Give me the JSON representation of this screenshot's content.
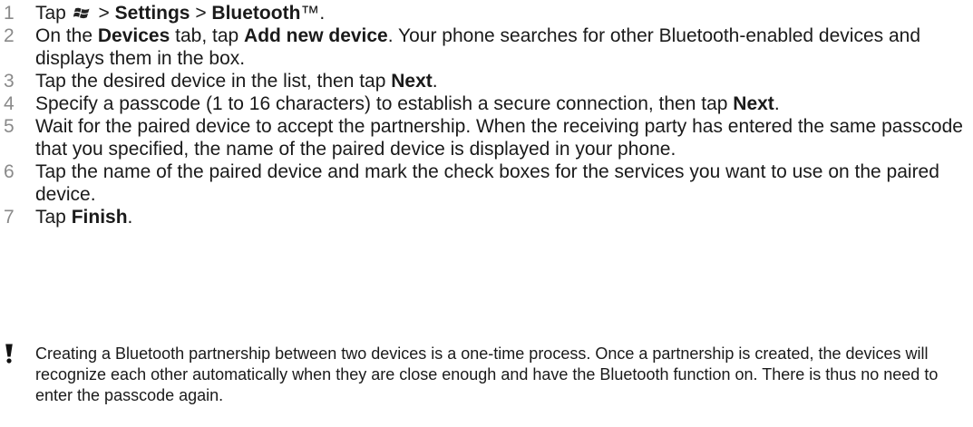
{
  "steps": [
    {
      "number": "1",
      "parts": [
        {
          "t": "Tap "
        },
        {
          "icon": "windows-start-icon"
        },
        {
          "t": " > "
        },
        {
          "b": "Settings"
        },
        {
          "t": " > "
        },
        {
          "b": "Bluetooth"
        },
        {
          "t": "™."
        }
      ]
    },
    {
      "number": "2",
      "parts": [
        {
          "t": "On the "
        },
        {
          "b": "Devices"
        },
        {
          "t": " tab, tap "
        },
        {
          "b": "Add new device"
        },
        {
          "t": ". Your phone searches for other Bluetooth-enabled devices and displays them in the box."
        }
      ]
    },
    {
      "number": "3",
      "parts": [
        {
          "t": "Tap the desired device in the list, then tap "
        },
        {
          "b": "Next"
        },
        {
          "t": "."
        }
      ]
    },
    {
      "number": "4",
      "parts": [
        {
          "t": "Specify a passcode (1 to 16 characters) to establish a secure connection, then tap "
        },
        {
          "b": "Next"
        },
        {
          "t": "."
        }
      ]
    },
    {
      "number": "5",
      "parts": [
        {
          "t": "Wait for the paired device to accept the partnership. When the receiving party has entered the same passcode that you specified, the name of the paired device is displayed in your phone."
        }
      ]
    },
    {
      "number": "6",
      "parts": [
        {
          "t": "Tap the name of the paired device and mark the check boxes for the services you want to use on the paired device."
        }
      ]
    },
    {
      "number": "7",
      "parts": [
        {
          "t": "Tap "
        },
        {
          "b": "Finish"
        },
        {
          "t": "."
        }
      ]
    }
  ],
  "note": {
    "icon": "exclamation-icon",
    "text": "Creating a Bluetooth partnership between two devices is a one-time process. Once a partnership is created, the devices will recognize each other automatically when they are close enough and have the Bluetooth function on. There is thus no need to enter the passcode again."
  },
  "colors": {
    "step_number": "#8a8a8a",
    "text": "#1a1a1a",
    "background": "#ffffff"
  }
}
